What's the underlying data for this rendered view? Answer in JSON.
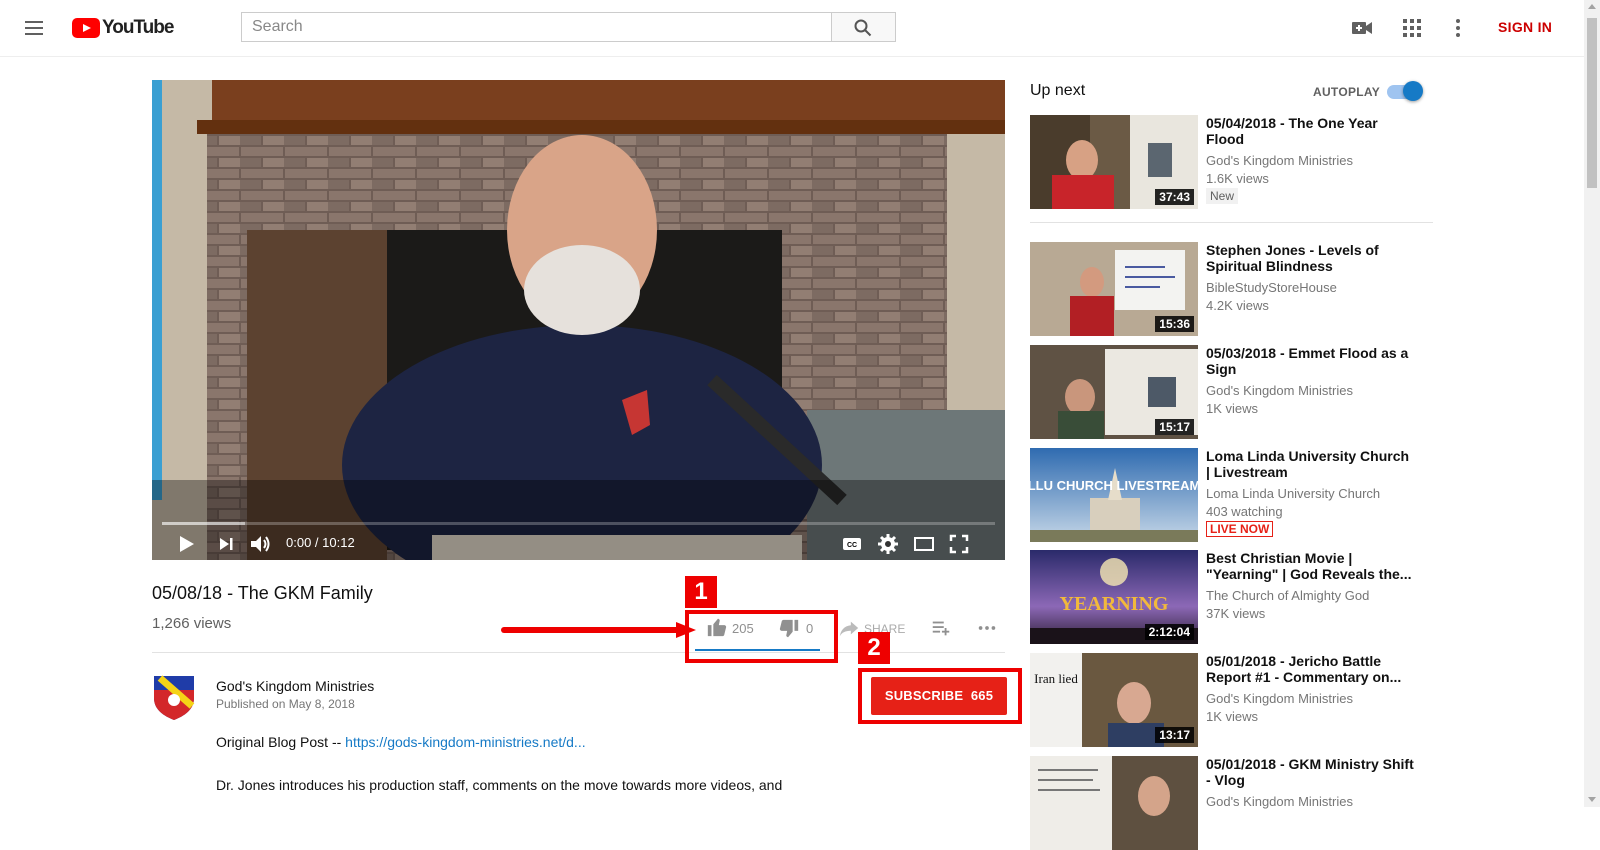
{
  "header": {
    "logo_text": "YouTube",
    "search": {
      "placeholder": "Search",
      "value": ""
    },
    "sign_in_label": "SIGN IN",
    "icons": [
      "menu-icon",
      "youtube-logo",
      "search-icon",
      "video-camera-icon",
      "apps-grid-icon",
      "more-vert-icon"
    ]
  },
  "player": {
    "time_current": "0:00",
    "time_total": "10:12",
    "time_display": "0:00 / 10:12",
    "progress_buffered_fraction": 0.1,
    "controls": [
      "play-icon",
      "next-icon",
      "volume-icon",
      "captions-icon",
      "settings-icon",
      "theater-icon",
      "fullscreen-icon"
    ]
  },
  "video": {
    "title": "05/08/18 - The GKM Family",
    "views": "1,266 views",
    "likes": "205",
    "dislikes": "0",
    "like_ratio": 1.0,
    "share_label": "SHARE"
  },
  "annotations": [
    {
      "number": "1"
    },
    {
      "number": "2"
    }
  ],
  "channel": {
    "name": "God's Kingdom Ministries",
    "published": "Published on May 8, 2018",
    "subscribe_label": "SUBSCRIBE",
    "subscriber_count": "665"
  },
  "description": {
    "line1_prefix": "Original Blog Post -- ",
    "line1_link": "https://gods-kingdom-ministries.net/d...",
    "line2": "Dr. Jones introduces his production staff, comments on the move towards more videos, and"
  },
  "sidebar": {
    "up_next_label": "Up next",
    "autoplay_label": "AUTOPLAY",
    "autoplay_on": true,
    "items": [
      {
        "title": "05/04/2018 - The One Year Flood",
        "channel": "God's Kingdom Ministries",
        "views": "1.6K views",
        "duration": "37:43",
        "badge": "New"
      },
      {
        "title": "Stephen Jones - Levels of Spiritual Blindness",
        "channel": "BibleStudyStoreHouse",
        "views": "4.2K views",
        "duration": "15:36"
      },
      {
        "title": "05/03/2018 - Emmet Flood as a Sign",
        "channel": "God's Kingdom Ministries",
        "views": "1K views",
        "duration": "15:17"
      },
      {
        "title": "Loma Linda University Church | Livestream",
        "channel": "Loma Linda University Church",
        "views": "403 watching",
        "badge": "LIVE NOW",
        "thumb_text": "LLU CHURCH LIVESTREAM"
      },
      {
        "title": "Best Christian Movie | \"Yearning\" | God Reveals the...",
        "channel": "The Church of Almighty God",
        "views": "37K views",
        "duration": "2:12:04",
        "thumb_text": "YEARNING"
      },
      {
        "title": "05/01/2018 - Jericho Battle Report #1 - Commentary on...",
        "channel": "God's Kingdom Ministries",
        "views": "1K views",
        "duration": "13:17",
        "thumb_text": "Iran lied"
      },
      {
        "title": "05/01/2018 - GKM Ministry Shift - Vlog",
        "channel": "God's Kingdom Ministries",
        "views": ""
      }
    ]
  }
}
